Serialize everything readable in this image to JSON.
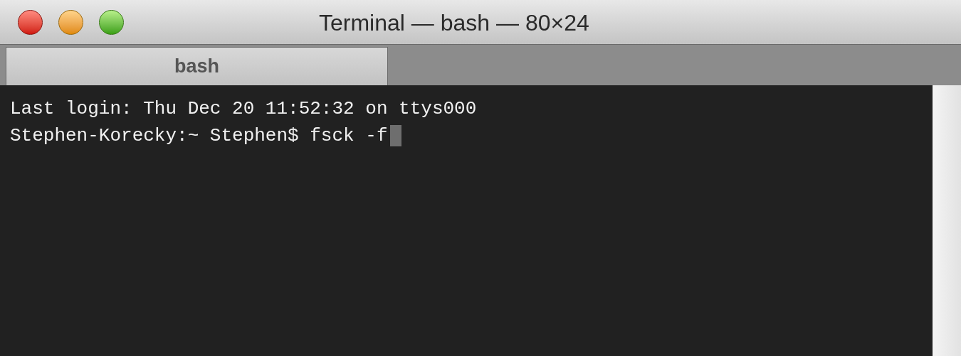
{
  "window": {
    "title": "Terminal — bash — 80×24"
  },
  "tabs": [
    {
      "label": "bash",
      "selected": true
    }
  ],
  "terminal": {
    "lines": [
      "Last login: Thu Dec 20 11:52:32 on ttys000",
      "Stephen-Korecky:~ Stephen$ fsck -f"
    ],
    "cursor_visible": true
  }
}
